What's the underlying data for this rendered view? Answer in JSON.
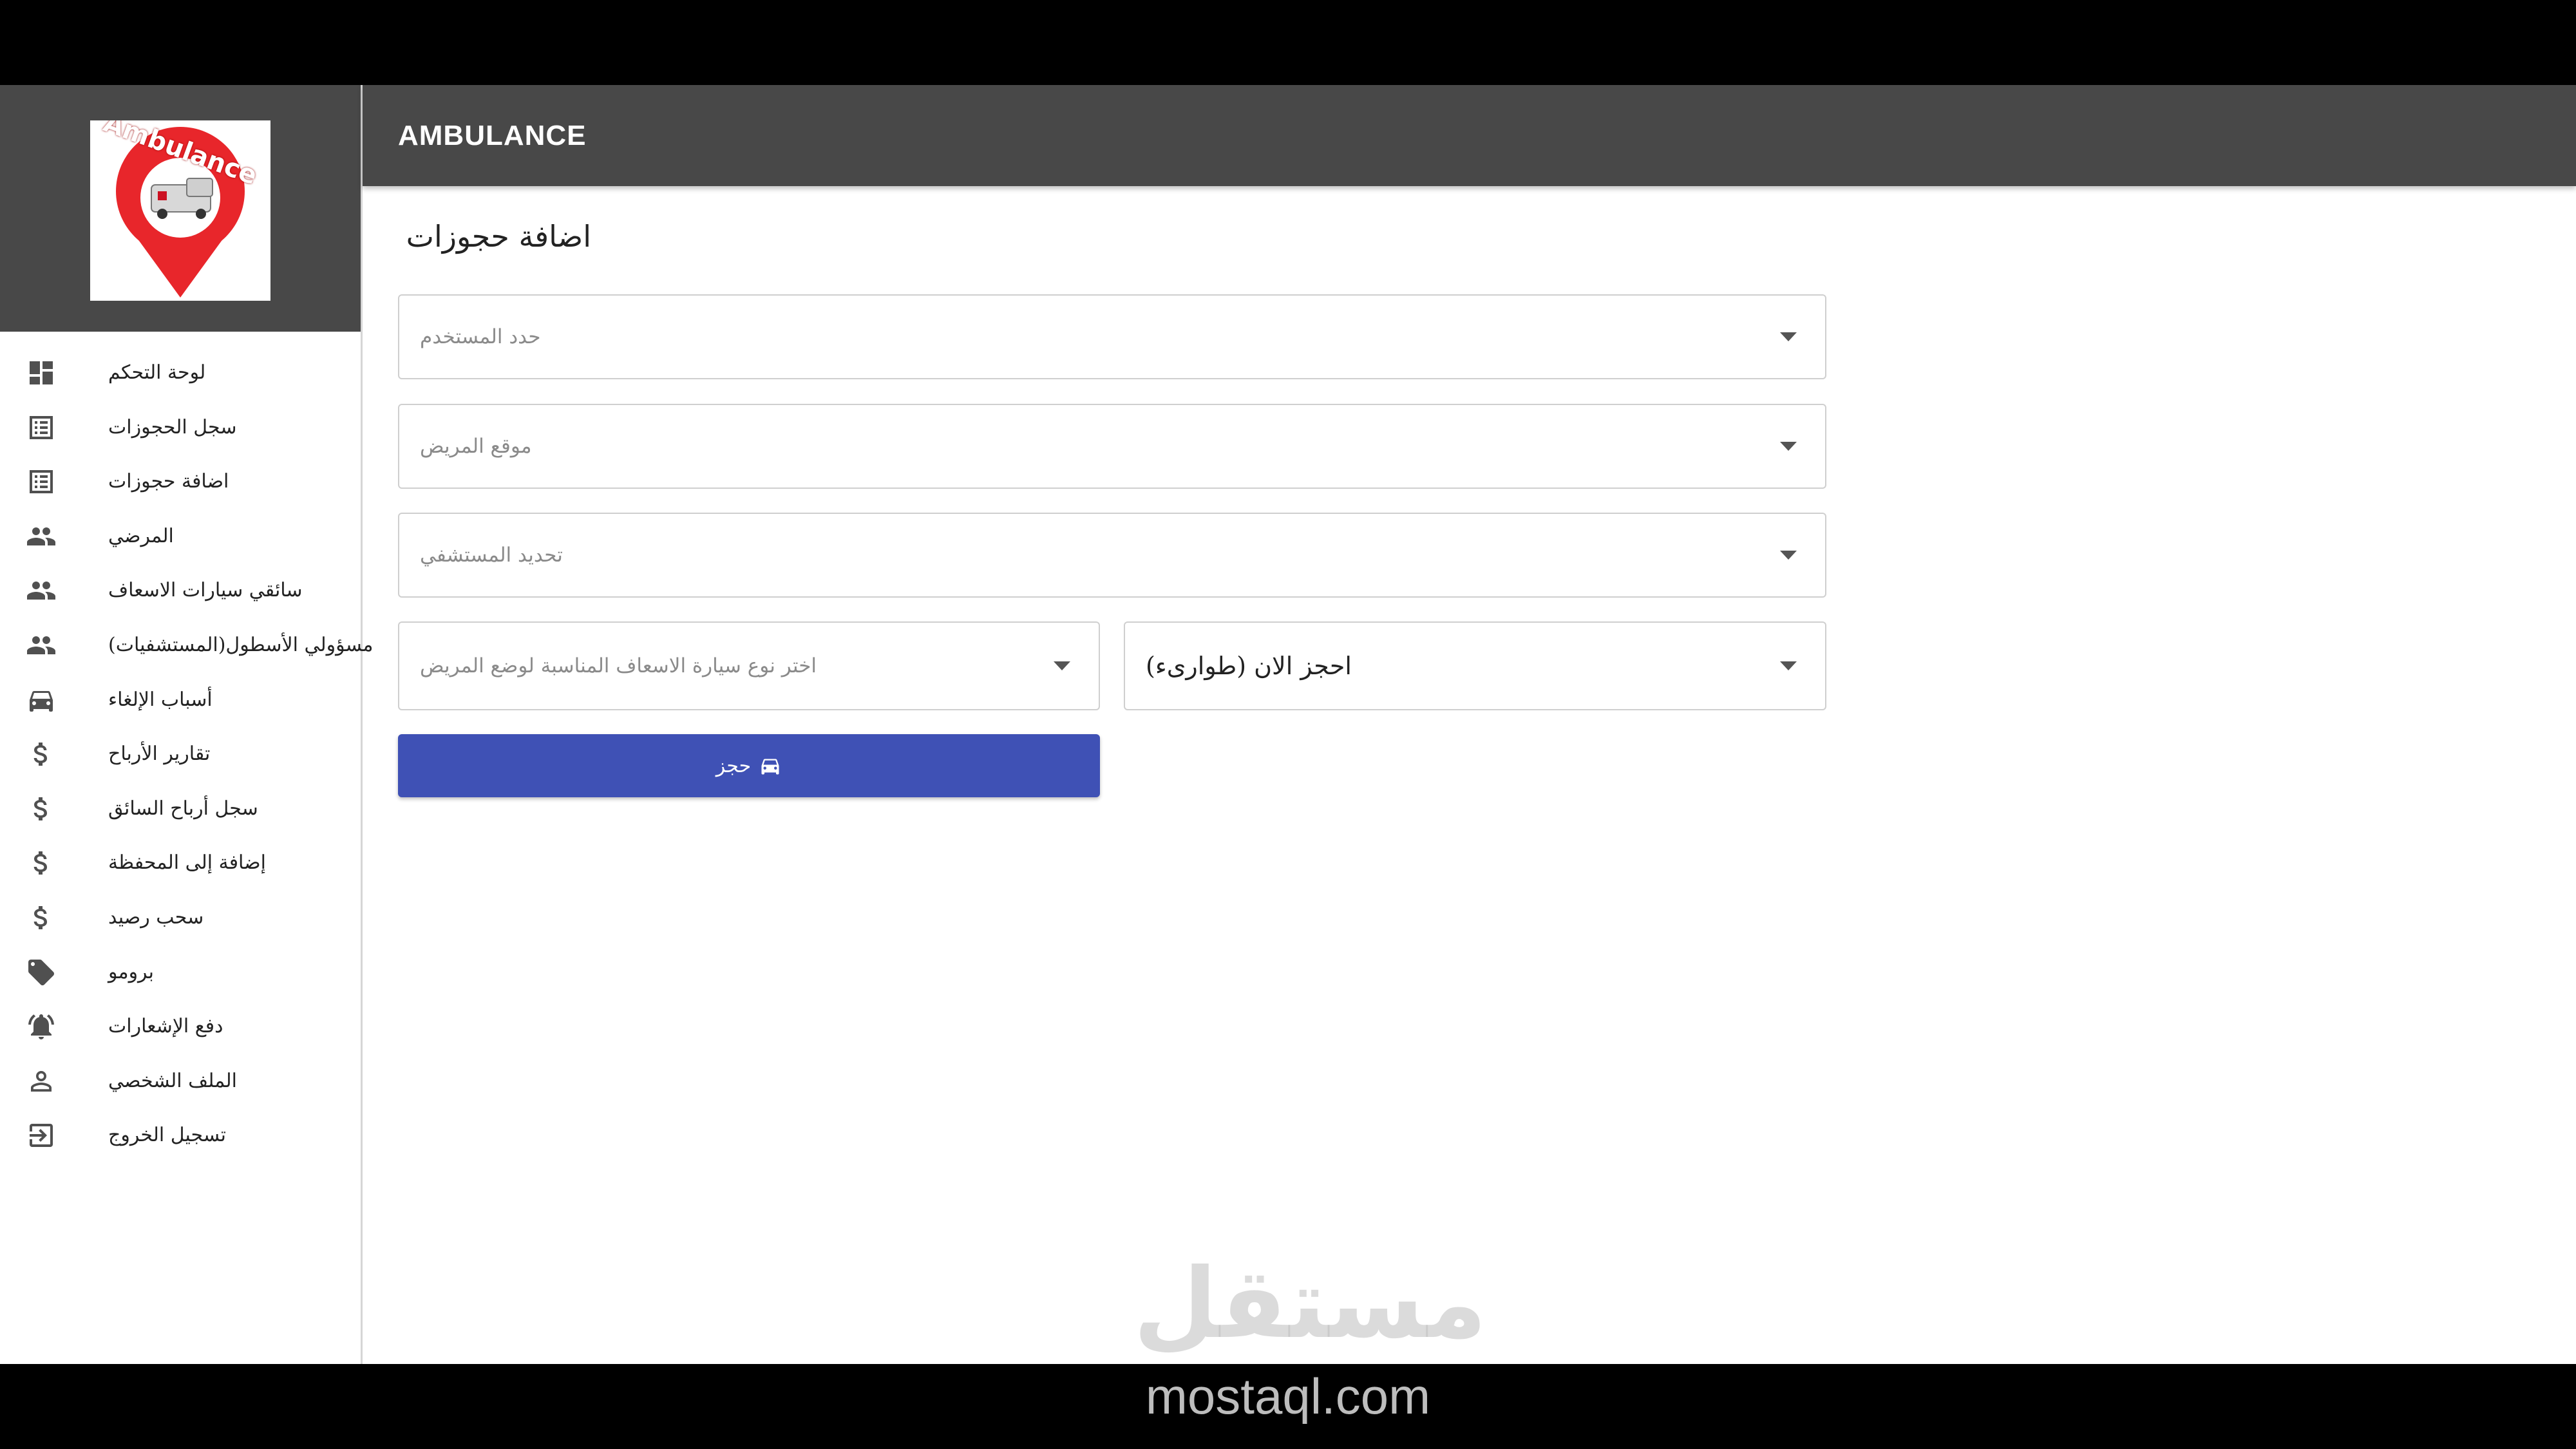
{
  "header": {
    "title": "AMBULANCE"
  },
  "logo": {
    "text": "Ambulance"
  },
  "sidebar": {
    "items": [
      {
        "label": "لوحة التحكم",
        "icon": "dashboard-icon"
      },
      {
        "label": "سجل الحجوزات",
        "icon": "list-icon"
      },
      {
        "label": "اضافة حجوزات",
        "icon": "list-icon"
      },
      {
        "label": "المرضي",
        "icon": "people-icon"
      },
      {
        "label": "سائقي سيارات الاسعاف",
        "icon": "people-icon"
      },
      {
        "label": "مسؤولي الأسطول(المستشفيات)",
        "icon": "people-icon"
      },
      {
        "label": "أسباب الإلغاء",
        "icon": "car-icon"
      },
      {
        "label": "تقارير الأرباح",
        "icon": "dollar-icon"
      },
      {
        "label": "سجل أرباح السائق",
        "icon": "dollar-icon"
      },
      {
        "label": "إضافة إلى المحفظة",
        "icon": "dollar-icon"
      },
      {
        "label": "سحب رصيد",
        "icon": "dollar-icon"
      },
      {
        "label": "برومو",
        "icon": "tag-icon"
      },
      {
        "label": "دفع الإشعارات",
        "icon": "bell-icon"
      },
      {
        "label": "الملف الشخصي",
        "icon": "person-icon"
      },
      {
        "label": "تسجيل الخروج",
        "icon": "logout-icon"
      }
    ]
  },
  "main": {
    "title": "اضافة حجوزات",
    "user_select": {
      "placeholder": "حدد المستخدم"
    },
    "location_select": {
      "placeholder": "موقع المريض"
    },
    "hospital_select": {
      "placeholder": "تحديد المستشفي"
    },
    "ambulance_type_select": {
      "placeholder": "اختر نوع سيارة الاسعاف المناسبة لوضع المريض"
    },
    "booking_time_select": {
      "value": "احجز الان (طوارىء)"
    },
    "book_button": {
      "label": "حجز"
    }
  },
  "watermark": {
    "arabic": "مستقل",
    "url": "mostaql.com"
  },
  "colors": {
    "header": "#484848",
    "button": "#3f51b5",
    "logo_pin": "#e8262b"
  }
}
